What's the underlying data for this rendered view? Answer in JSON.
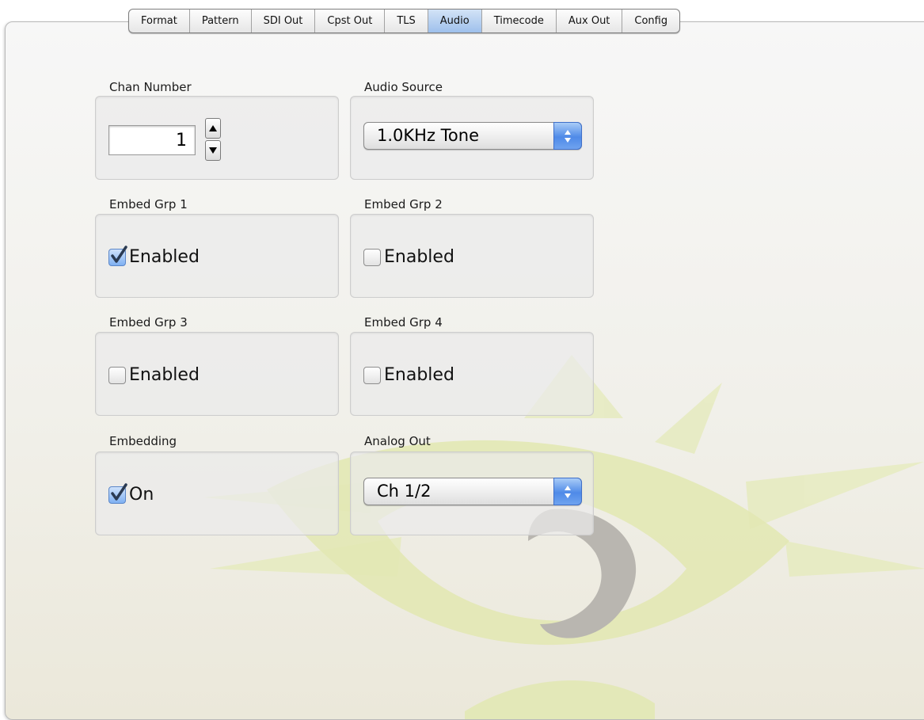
{
  "tabs": [
    {
      "label": "Format"
    },
    {
      "label": "Pattern"
    },
    {
      "label": "SDI Out"
    },
    {
      "label": "Cpst Out"
    },
    {
      "label": "TLS"
    },
    {
      "label": "Audio"
    },
    {
      "label": "Timecode"
    },
    {
      "label": "Aux Out"
    },
    {
      "label": "Config"
    }
  ],
  "active_tab": "Audio",
  "chan_number": {
    "label": "Chan Number",
    "value": "1"
  },
  "audio_source": {
    "label": "Audio Source",
    "value": "1.0KHz Tone"
  },
  "embed_grp1": {
    "label": "Embed Grp 1",
    "checkbox_label": "Enabled",
    "checked": true
  },
  "embed_grp2": {
    "label": "Embed Grp 2",
    "checkbox_label": "Enabled",
    "checked": false
  },
  "embed_grp3": {
    "label": "Embed Grp 3",
    "checkbox_label": "Enabled",
    "checked": false
  },
  "embed_grp4": {
    "label": "Embed Grp 4",
    "checkbox_label": "Enabled",
    "checked": false
  },
  "embedding": {
    "label": "Embedding",
    "checkbox_label": "On",
    "checked": true
  },
  "analog_out": {
    "label": "Analog Out",
    "value": "Ch 1/2"
  },
  "colors": {
    "accent": "#4f8ae8",
    "tab_active": "#b8d2f2",
    "watermark_green": "#e6ebb8",
    "watermark_gray": "#b9b6b0"
  }
}
